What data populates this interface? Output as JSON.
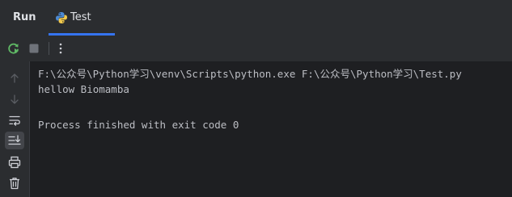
{
  "header": {
    "title": "Run",
    "tab": {
      "label": "Test",
      "icon": "python-icon"
    }
  },
  "toolbar": {
    "icons": [
      "rerun-icon",
      "stop-icon",
      "more-options-icon"
    ]
  },
  "gutter": {
    "icons": [
      "arrow-up-icon",
      "arrow-down-icon",
      "soft-wrap-icon",
      "scroll-to-end-icon",
      "print-icon",
      "trash-icon"
    ]
  },
  "console": {
    "lines": [
      "F:\\公众号\\Python学习\\venv\\Scripts\\python.exe F:\\公众号\\Python学习\\Test.py",
      "hellow Biomamba",
      "",
      "Process finished with exit code 0"
    ]
  },
  "colors": {
    "accent": "#3574f0",
    "panel_bg": "#2b2d30",
    "console_bg": "#1e1f22",
    "text": "#bcbec4",
    "rerun_green": "#5fb865"
  }
}
